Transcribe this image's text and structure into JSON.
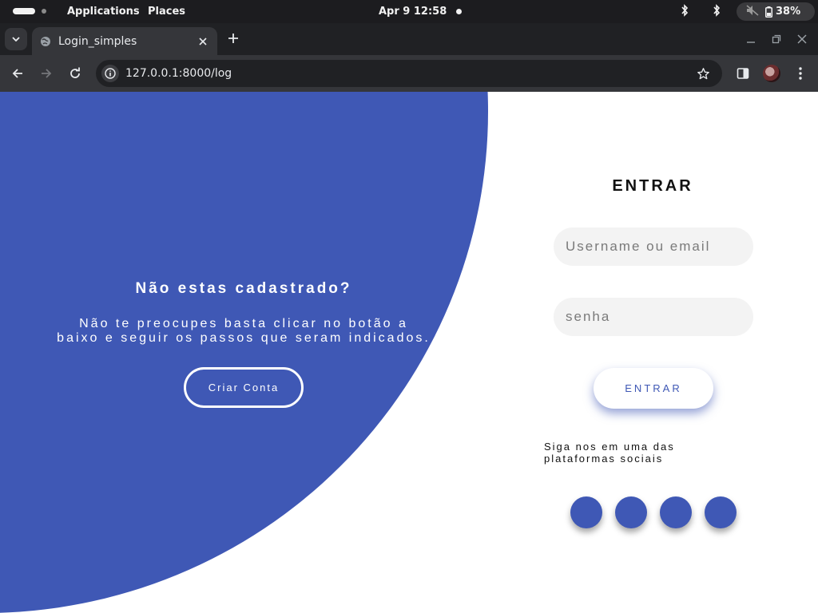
{
  "system_bar": {
    "applications": "Applications",
    "places": "Places",
    "clock": "Apr 9  12:58",
    "battery": "38%"
  },
  "browser": {
    "tab_title": "Login_simples",
    "url": "127.0.0.1:8000/log"
  },
  "signup_panel": {
    "title": "Não estas cadastrado?",
    "text": "Não te preocupes basta clicar no botão a baixo e seguir os passos que seram indicados.",
    "button": "Criar Conta"
  },
  "login_panel": {
    "title": "ENTRAR",
    "username_placeholder": "Username ou email",
    "password_placeholder": "senha",
    "button": "ENTRAR",
    "social_caption": "Siga nos em uma das plataformas sociais"
  },
  "colors": {
    "accent": "#3f58b5",
    "browser_dark": "#202124",
    "browser_toolbar": "#35363a"
  }
}
